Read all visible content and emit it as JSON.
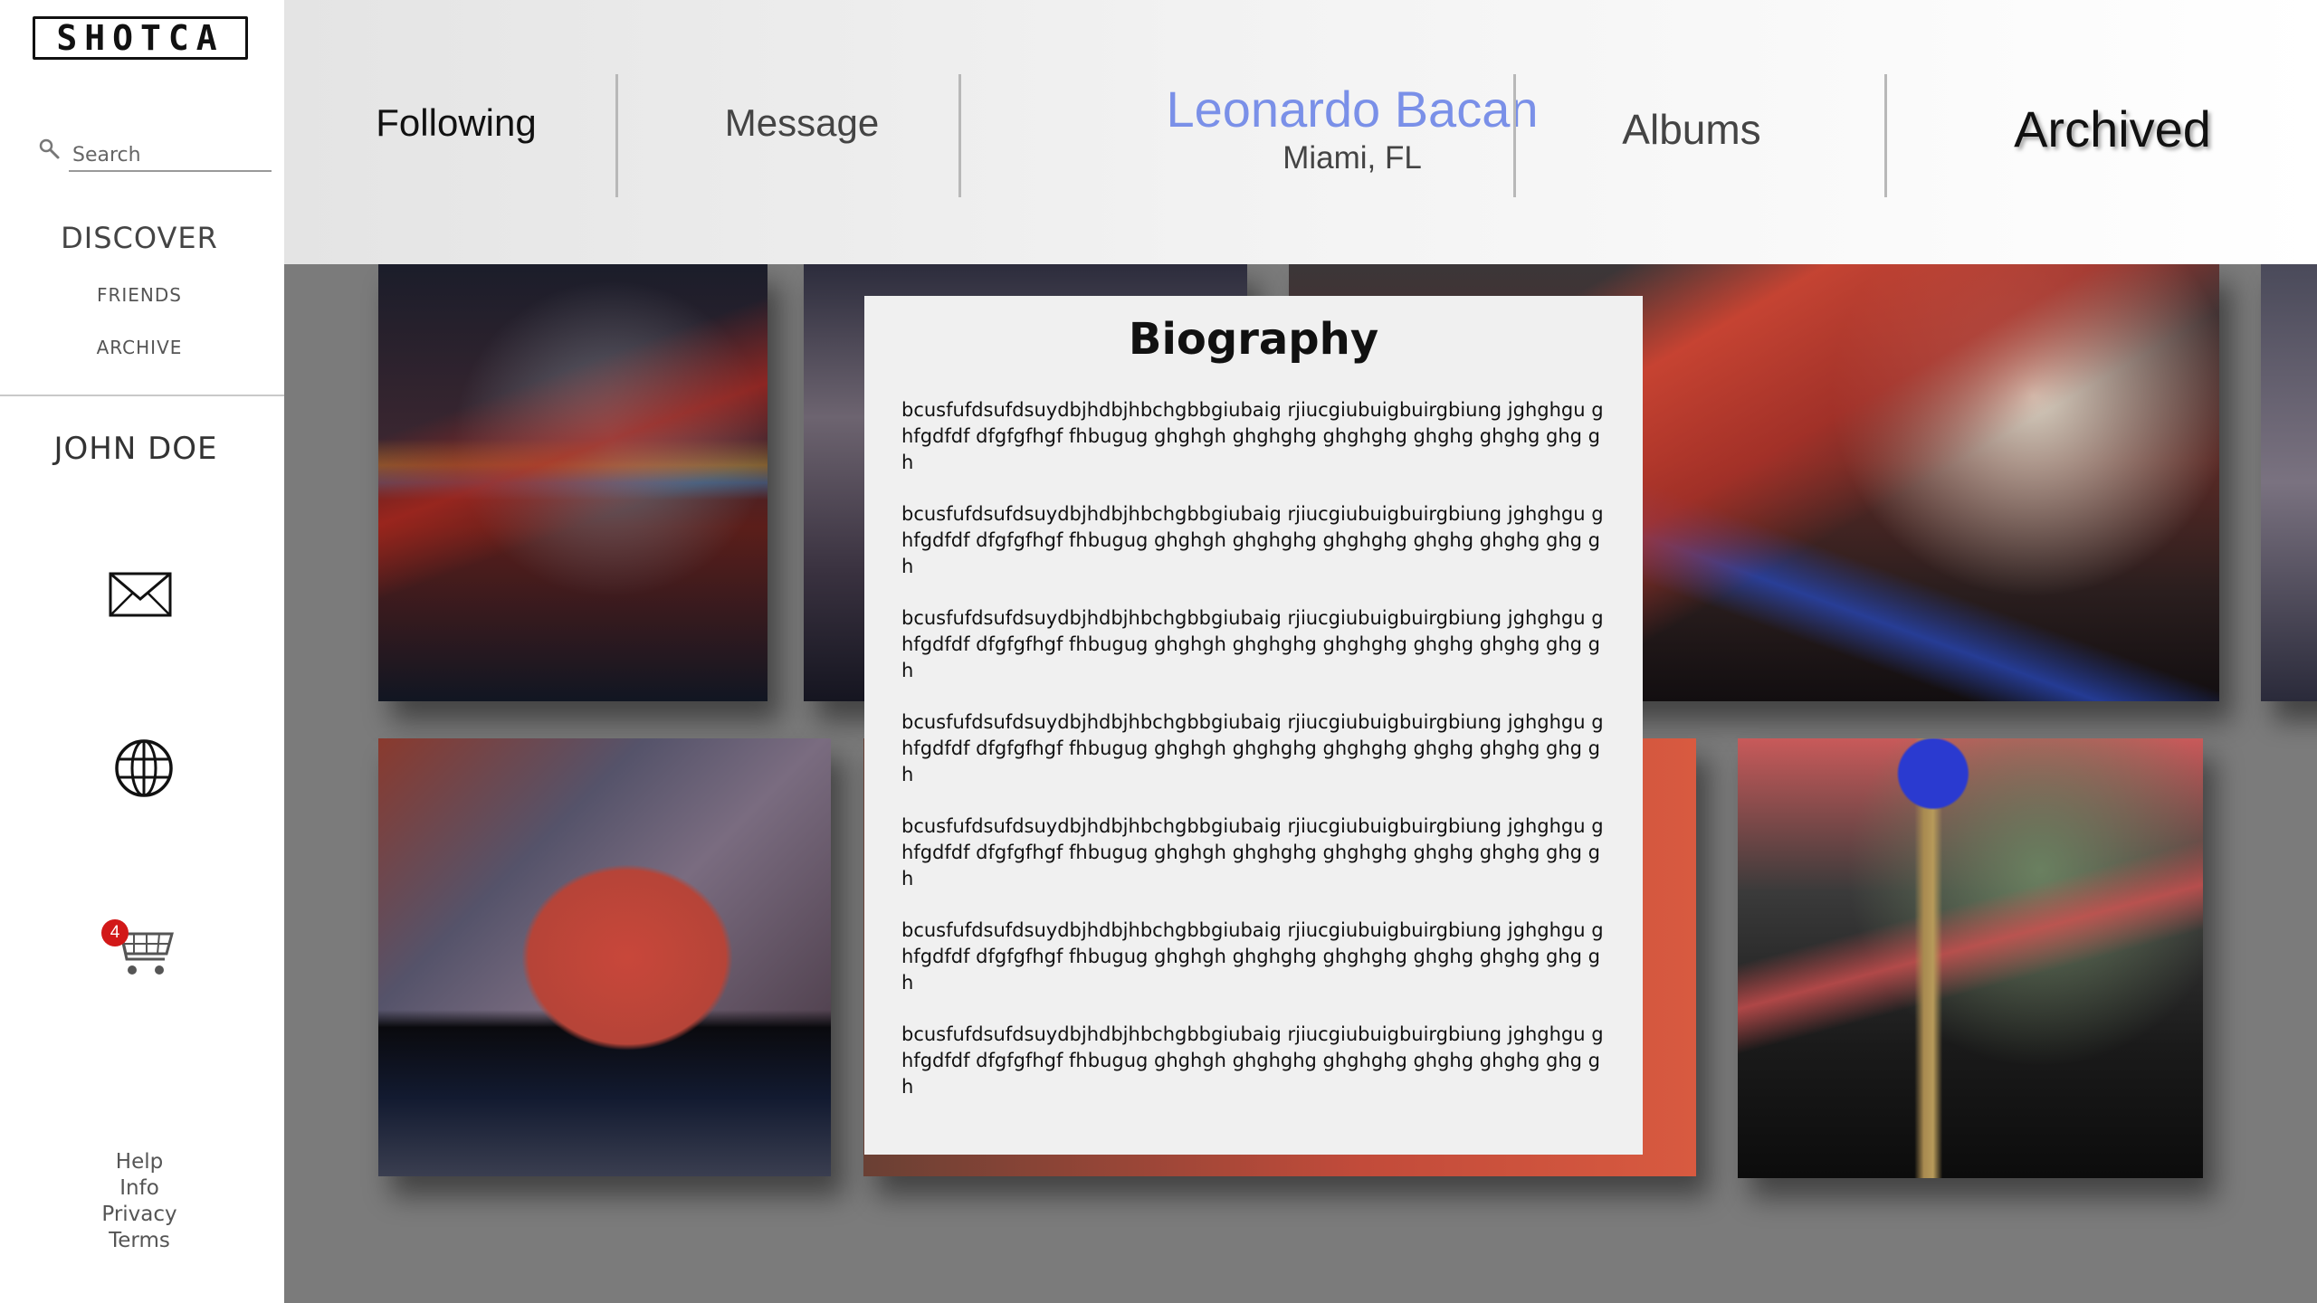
{
  "app": {
    "logo_text": "SHOTCA"
  },
  "sidebar": {
    "search_placeholder": "Search",
    "discover_label": "DISCOVER",
    "friends_label": "FRIENDS",
    "archive_label": "ARCHIVE",
    "user_name": "JOHN DOE",
    "cart_count": "4",
    "footer": {
      "help": "Help",
      "info": "Info",
      "privacy": "Privacy",
      "terms": "Terms"
    }
  },
  "header": {
    "following_label": "Following",
    "message_label": "Message",
    "profile_name": "Leonardo Bacan",
    "profile_location": "Miami, FL",
    "albums_label": "Albums",
    "archived_label": "Archived"
  },
  "biography": {
    "title": "Biography",
    "paragraphs": [
      "bcusfufdsufdsuydbjhdbjhbchgbbgiubaig  rjiucgiubuigbuirgbiung jghghgu ghfgdfdf dfgfgfhgf fhbugug ghghgh ghghghg ghghghg ghghg ghghg ghg gh",
      "bcusfufdsufdsuydbjhdbjhbchgbbgiubaig  rjiucgiubuigbuirgbiung jghghgu ghfgdfdf dfgfgfhgf fhbugug ghghgh ghghghg ghghghg ghghg ghghg ghg gh",
      "bcusfufdsufdsuydbjhdbjhbchgbbgiubaig  rjiucgiubuigbuirgbiung jghghgu ghfgdfdf dfgfgfhgf fhbugug ghghgh ghghghg ghghghg ghghg ghghg ghg gh",
      "bcusfufdsufdsuydbjhdbjhbchgbbgiubaig  rjiucgiubuigbuirgbiung jghghgu ghfgdfdf dfgfgfhgf fhbugug ghghgh ghghghg ghghghg ghghg ghghg ghg gh",
      "bcusfufdsufdsuydbjhdbjhbchgbbgiubaig  rjiucgiubuigbuirgbiung jghghgu ghfgdfdf dfgfgfhgf fhbugug ghghgh ghghghg ghghghg ghghg ghghg ghg gh",
      "bcusfufdsufdsuydbjhdbjhbchgbbgiubaig  rjiucgiubuigbuirgbiung jghghgu ghfgdfdf dfgfgfhgf fhbugug ghghgh ghghghg ghghghg ghghg ghghg ghg gh",
      "bcusfufdsufdsuydbjhdbjhbchgbbgiubaig  rjiucgiubuigbuirgbiung jghghgu ghfgdfdf dfgfgfhgf fhbugug ghghgh ghghghg ghghghg ghghg ghghg ghg gh"
    ]
  },
  "icons": {
    "search": "search-icon",
    "mail": "mail-icon",
    "globe": "globe-icon",
    "cart": "cart-icon"
  },
  "colors": {
    "profile_name": "#7a90e8",
    "cart_badge": "#d21818",
    "gallery_background": "#7b7b7b",
    "modal_background": "#f0f0f0"
  }
}
